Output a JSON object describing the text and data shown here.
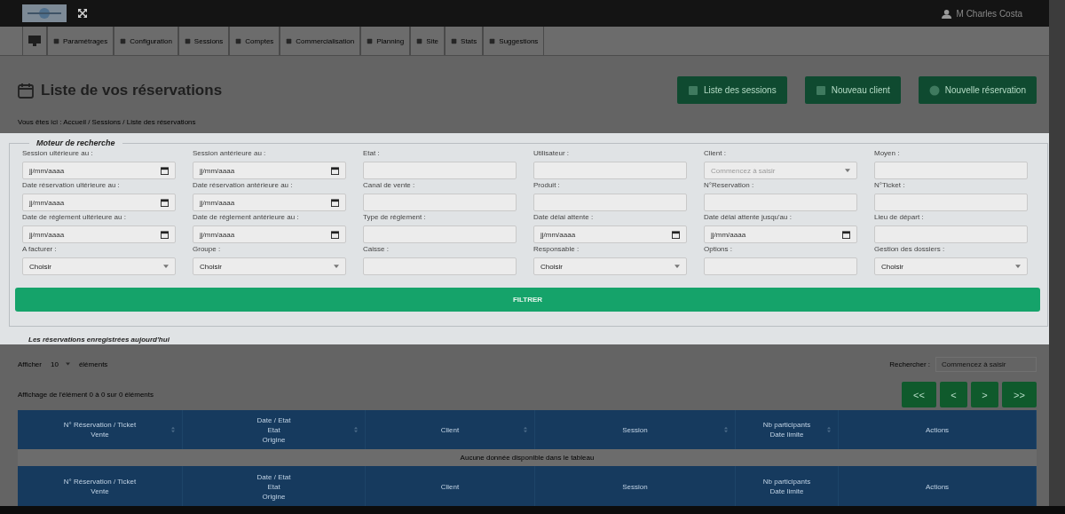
{
  "top_bar": {
    "user": "M Charles Costa"
  },
  "nav": {
    "items": [
      {
        "kind": "icon"
      },
      {
        "label": "Paramétrages"
      },
      {
        "label": "Configuration"
      },
      {
        "label": "Sessions"
      },
      {
        "label": "Comptes"
      },
      {
        "label": "Commercialisation"
      },
      {
        "label": "Planning"
      },
      {
        "label": "Site"
      },
      {
        "label": "Stats"
      },
      {
        "label": "Suggestions"
      }
    ]
  },
  "header": {
    "title": "Liste de vos réservations",
    "buttons": [
      "Liste des sessions",
      "Nouveau client",
      "Nouvelle réservation"
    ],
    "breadcrumb": "Vous êtes ici : Accueil / Sessions / Liste des réservations"
  },
  "search_panel": {
    "legend": "Moteur de recherche",
    "fields": [
      {
        "label": "Session ultérieure au :",
        "kind": "date",
        "placeholder": "jj/mm/aaaa"
      },
      {
        "label": "Session antérieure au :",
        "kind": "date",
        "placeholder": "jj/mm/aaaa"
      },
      {
        "label": "Etat :",
        "kind": "text"
      },
      {
        "label": "Utilisateur :",
        "kind": "text"
      },
      {
        "label": "Client :",
        "kind": "combo",
        "placeholder": "Commencez à saisir"
      },
      {
        "label": "Moyen :",
        "kind": "text"
      },
      {
        "label": "Date réservation ultérieure au :",
        "kind": "date",
        "placeholder": "jj/mm/aaaa"
      },
      {
        "label": "Date réservation antérieure au :",
        "kind": "date",
        "placeholder": "jj/mm/aaaa"
      },
      {
        "label": "Canal de vente :",
        "kind": "text"
      },
      {
        "label": "Produit :",
        "kind": "text"
      },
      {
        "label": "N°Reservation :",
        "kind": "text"
      },
      {
        "label": "N°Ticket :",
        "kind": "text"
      },
      {
        "label": "Date de réglement ultérieure au :",
        "kind": "date",
        "placeholder": "jj/mm/aaaa"
      },
      {
        "label": "Date de réglement antérieure au :",
        "kind": "date",
        "placeholder": "jj/mm/aaaa"
      },
      {
        "label": "Type de réglement :",
        "kind": "text"
      },
      {
        "label": "Date délai attente :",
        "kind": "date",
        "placeholder": "jj/mm/aaaa"
      },
      {
        "label": "Date délai attente jusqu'au :",
        "kind": "date",
        "placeholder": "jj/mm/aaaa"
      },
      {
        "label": "Lieu de départ :",
        "kind": "text"
      },
      {
        "label": "A facturer :",
        "kind": "select",
        "value": "Choisir"
      },
      {
        "label": "Groupe :",
        "kind": "select",
        "value": "Choisir"
      },
      {
        "label": "Caisse :",
        "kind": "text"
      },
      {
        "label": "Responsable :",
        "kind": "select",
        "value": "Choisir"
      },
      {
        "label": "Options :",
        "kind": "text"
      },
      {
        "label": "Gestion des dossiers :",
        "kind": "select",
        "value": "Choisir"
      }
    ],
    "filter_button": "FILTRER",
    "next_legend": "Les réservations enregistrées aujourd'hui"
  },
  "table": {
    "show_label": "Afficher",
    "page_size": "10",
    "show_suffix": "éléments",
    "search_label": "Rechercher :",
    "search_placeholder": "Commencez à saisir",
    "info": "Affichage de l'élément 0 à 0 sur 0 éléments",
    "pagination": [
      "<<",
      "<",
      ">",
      ">>"
    ],
    "columns": [
      [
        "N° Réservation / Ticket",
        "Vente"
      ],
      [
        "Date / Etat",
        "Etat",
        "Origine"
      ],
      [
        "Client"
      ],
      [
        "Session"
      ],
      [
        "Nb participants",
        "Date limite"
      ],
      [
        "Actions"
      ]
    ],
    "empty": "Aucune donnée disponible dans le tableau",
    "footer_columns": [
      [
        "N° Réservation / Ticket",
        "Vente"
      ],
      [
        "Date / Etat",
        "Etat",
        "Origine"
      ],
      [
        "Client"
      ],
      [
        "Session"
      ],
      [
        "Nb participants",
        "Date limite"
      ],
      [
        "Actions"
      ]
    ]
  }
}
